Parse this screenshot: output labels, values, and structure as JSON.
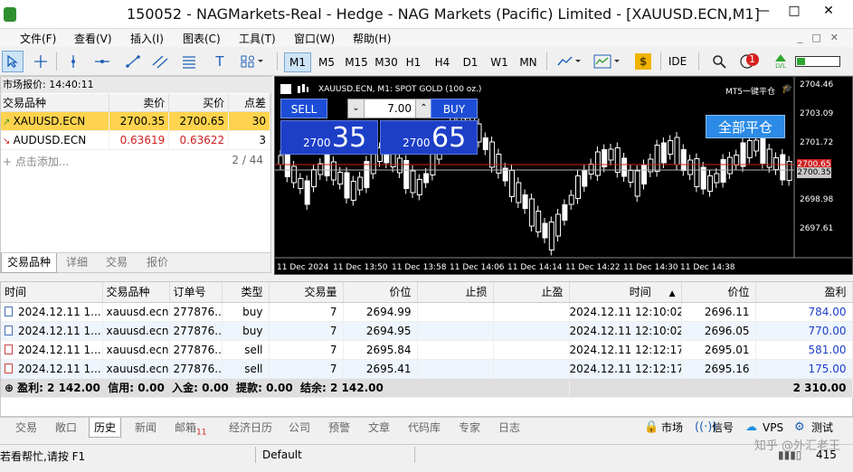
{
  "window": {
    "title": "150052 - NAGMarkets-Real - Hedge - NAG Markets (Pacific) Limited - [XAUUSD.ECN,M1]",
    "minimize": "—",
    "restore": "□",
    "close": "✕"
  },
  "menu": [
    "文件(F)",
    "查看(V)",
    "插入(I)",
    "图表(C)",
    "工具(T)",
    "窗口(W)",
    "帮助(H)"
  ],
  "toolbar": {
    "timeframes": [
      "M1",
      "M5",
      "M15",
      "M30",
      "H1",
      "H4",
      "D1",
      "W1",
      "MN"
    ],
    "selected_timeframe": "M1",
    "ide": "IDE",
    "notification_count": "1",
    "lvl": "LVL"
  },
  "market_watch": {
    "title": "市场报价: 14:40:11",
    "columns": [
      "交易品种",
      "卖价",
      "买价",
      "点差"
    ],
    "rows": [
      {
        "symbol": "XAUUSD.ECN",
        "bid": "2700.35",
        "ask": "2700.65",
        "spread": "30"
      },
      {
        "symbol": "AUDUSD.ECN",
        "bid": "0.63619",
        "ask": "0.63622",
        "spread": "3"
      }
    ],
    "add_label": "点击添加...",
    "count": "2 / 44",
    "tabs": [
      "交易品种",
      "详细",
      "交易",
      "报价"
    ]
  },
  "chart": {
    "title": "XAUUSD.ECN, M1:  SPOT GOLD (100 oz.)",
    "top_right": "MT5一键平仓",
    "sell_label": "SELL",
    "buy_label": "BUY",
    "volume": "7.00",
    "sell_price_small": "2700",
    "sell_price_big": "35",
    "buy_price_small": "2700",
    "buy_price_big": "65",
    "close_all": "全部平仓",
    "y_labels": [
      "2704.46",
      "2703.09",
      "2701.72",
      "2700.35",
      "2698.98",
      "2697.61"
    ],
    "x_labels": [
      "11 Dec 2024",
      "11 Dec 13:50",
      "11 Dec 13:58",
      "11 Dec 14:06",
      "11 Dec 14:14",
      "11 Dec 14:22",
      "11 Dec 14:30",
      "11 Dec 14:38"
    ],
    "ask_tag": "2700.65",
    "bid_tag": "2700.35"
  },
  "terminal": {
    "columns": [
      "时间",
      "交易品种",
      "订单号",
      "类型",
      "交易量",
      "价位",
      "止损",
      "止盈",
      "时间",
      "价位",
      "盈利"
    ],
    "sort_arrow": "▲",
    "rows": [
      {
        "time": "2024.12.11 1...",
        "symbol": "xauusd.ecn",
        "order": "277876...",
        "type": "buy",
        "volume": "7",
        "price": "2694.99",
        "sl": "",
        "tp": "",
        "close_time": "2024.12.11 12:10:02",
        "close_price": "2696.11",
        "profit": "784.00"
      },
      {
        "time": "2024.12.11 1...",
        "symbol": "xauusd.ecn",
        "order": "277876...",
        "type": "buy",
        "volume": "7",
        "price": "2694.95",
        "sl": "",
        "tp": "",
        "close_time": "2024.12.11 12:10:02",
        "close_price": "2696.05",
        "profit": "770.00"
      },
      {
        "time": "2024.12.11 1...",
        "symbol": "xauusd.ecn",
        "order": "277876...",
        "type": "sell",
        "volume": "7",
        "price": "2695.84",
        "sl": "",
        "tp": "",
        "close_time": "2024.12.11 12:12:17",
        "close_price": "2695.01",
        "profit": "581.00"
      },
      {
        "time": "2024.12.11 1...",
        "symbol": "xauusd.ecn",
        "order": "277876...",
        "type": "sell",
        "volume": "7",
        "price": "2695.41",
        "sl": "",
        "tp": "",
        "close_time": "2024.12.11 12:12:17",
        "close_price": "2695.16",
        "profit": "175.00"
      }
    ],
    "summary": "盈利: 2 142.00  信用: 0.00  入金: 0.00  提款: 0.00  结余: 2 142.00",
    "summary_total": "2 310.00"
  },
  "bottom_tabs": [
    "交易",
    "敞口",
    "历史",
    "新闻",
    "邮箱",
    "经济日历",
    "公司",
    "预警",
    "文章",
    "代码库",
    "专家",
    "日志"
  ],
  "active_bottom_tab": "历史",
  "mailbox_count": "11",
  "bottom_right": [
    "市场",
    "信号",
    "VPS",
    "测试"
  ],
  "status": {
    "help": "若看帮忙,请按 F1",
    "profile": "Default",
    "watermark": "知乎 @外汇老王",
    "signal": "415"
  }
}
